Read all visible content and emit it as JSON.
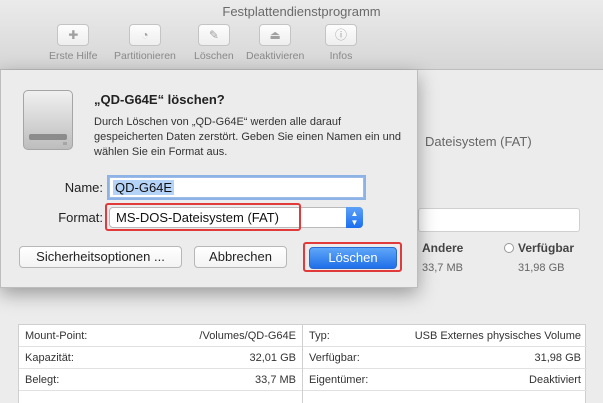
{
  "window": {
    "title": "Festplattendienstprogramm"
  },
  "toolbar": {
    "items": [
      {
        "label": "Erste Hilfe",
        "icon": "stethoscope-icon",
        "glyph": "✚"
      },
      {
        "label": "Partitionieren",
        "icon": "pie-partition-icon",
        "glyph": "◔"
      },
      {
        "label": "Löschen",
        "icon": "erase-icon",
        "glyph": "✎"
      },
      {
        "label": "Deaktivieren",
        "icon": "eject-icon",
        "glyph": "⏏"
      },
      {
        "label": "Infos",
        "icon": "info-icon",
        "glyph": "ⓘ"
      }
    ]
  },
  "background": {
    "filesystem": "Dateisystem (FAT)",
    "stats": {
      "other_label": "Andere",
      "other_value": "33,7 MB",
      "free_label": "Verfügbar",
      "free_value": "31,98 GB"
    },
    "info_left": [
      {
        "key": "Mount-Point:",
        "value": "/Volumes/QD-G64E"
      },
      {
        "key": "Kapazität:",
        "value": "32,01 GB"
      },
      {
        "key": "Belegt:",
        "value": "33,7 MB"
      }
    ],
    "info_right": [
      {
        "key": "Typ:",
        "value": "USB Externes physisches Volume"
      },
      {
        "key": "Verfügbar:",
        "value": "31,98 GB"
      },
      {
        "key": "Eigentümer:",
        "value": "Deaktiviert"
      }
    ]
  },
  "dialog": {
    "title": "„QD-G64E“ löschen?",
    "description": "Durch Löschen von „QD-G64E“ werden alle darauf gespeicherten Daten zerstört. Geben Sie einen Namen ein und wählen Sie ein Format aus.",
    "name_label": "Name:",
    "name_value": "QD-G64E",
    "format_label": "Format:",
    "format_value": "MS-DOS-Dateisystem (FAT)",
    "security_button": "Sicherheitsoptionen ...",
    "cancel_button": "Abbrechen",
    "erase_button": "Löschen",
    "highlight_color": "#e03a3a",
    "accent_color": "#1f6fe9"
  }
}
